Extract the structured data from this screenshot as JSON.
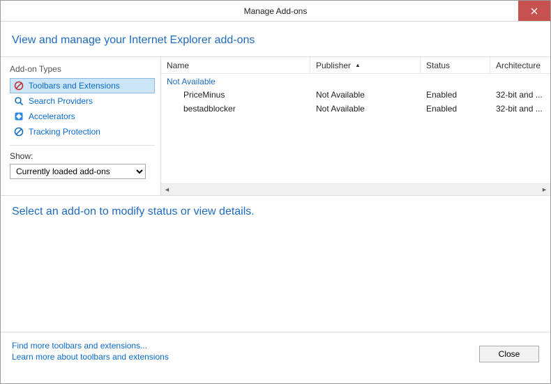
{
  "window": {
    "title": "Manage Add-ons"
  },
  "header": {
    "title": "View and manage your Internet Explorer add-ons"
  },
  "sidebar": {
    "types_heading": "Add-on Types",
    "items": [
      {
        "label": "Toolbars and Extensions"
      },
      {
        "label": "Search Providers"
      },
      {
        "label": "Accelerators"
      },
      {
        "label": "Tracking Protection"
      }
    ],
    "show_label": "Show:",
    "show_value": "Currently loaded add-ons"
  },
  "grid": {
    "columns": {
      "name": "Name",
      "publisher": "Publisher",
      "status": "Status",
      "architecture": "Architecture"
    },
    "group": "Not Available",
    "rows": [
      {
        "name": "PriceMinus",
        "publisher": "Not Available",
        "status": "Enabled",
        "architecture": "32-bit and ..."
      },
      {
        "name": "bestadblocker",
        "publisher": "Not Available",
        "status": "Enabled",
        "architecture": "32-bit and ..."
      }
    ]
  },
  "detail": {
    "prompt": "Select an add-on to modify status or view details."
  },
  "footer": {
    "link_find": "Find more toolbars and extensions...",
    "link_learn": "Learn more about toolbars and extensions",
    "close": "Close"
  }
}
